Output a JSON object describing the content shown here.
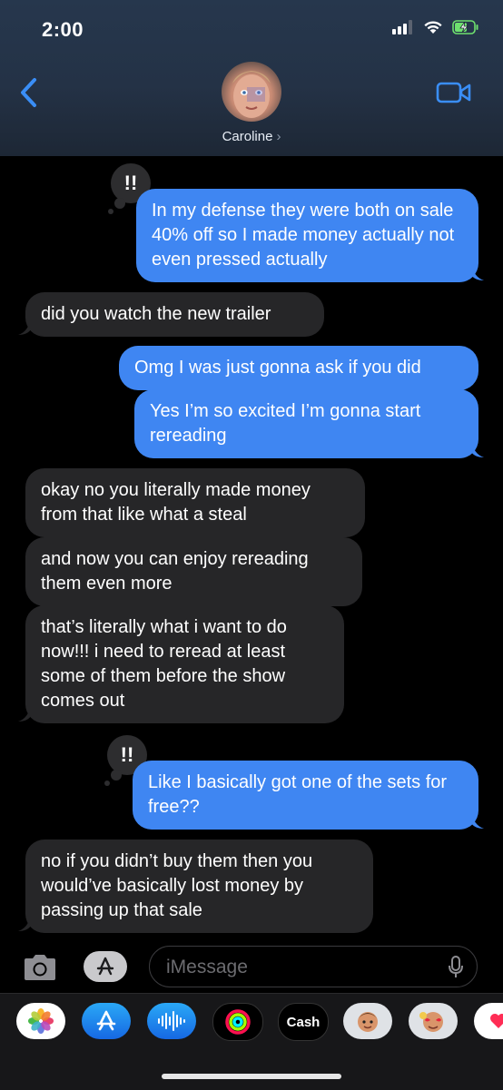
{
  "status_bar": {
    "time": "2:00"
  },
  "header": {
    "contact_name": "Caroline",
    "chevron": "›"
  },
  "messages": [
    {
      "side": "sent",
      "text": "In my defense they were both on sale 40% off so I made money actually not even pressed actually",
      "tapback": "!!"
    },
    {
      "side": "received",
      "text": "did you watch the new trailer"
    },
    {
      "side": "sent",
      "text": "Omg I was just gonna ask if you did"
    },
    {
      "side": "sent",
      "text": "Yes I’m so excited I’m gonna start rereading"
    },
    {
      "side": "received",
      "text": "okay no you literally made money from that like what a steal"
    },
    {
      "side": "received",
      "text": "and now you can enjoy rereading them even more"
    },
    {
      "side": "received",
      "text": "that’s literally what i want to do now!!! i need to reread at least some of them before the show comes out"
    },
    {
      "side": "sent",
      "text": "Like I basically got one of the sets for free??",
      "tapback": "!!"
    },
    {
      "side": "received",
      "text": "no if you didn’t buy them then you would’ve basically lost money by passing up that sale"
    }
  ],
  "input": {
    "placeholder": "iMessage"
  },
  "app_drawer": {
    "items": [
      "photos-icon",
      "app-store-icon",
      "audio-message-icon",
      "activity-icon",
      "apple-cash-icon",
      "memoji-stickers-icon",
      "animoji-icon",
      "digital-touch-icon"
    ],
    "cash_label": "Cash",
    "cash_logo": ""
  },
  "colors": {
    "sent_bubble": "#3f86f2",
    "received_bubble": "#262628",
    "accent": "#3a8ef6"
  }
}
